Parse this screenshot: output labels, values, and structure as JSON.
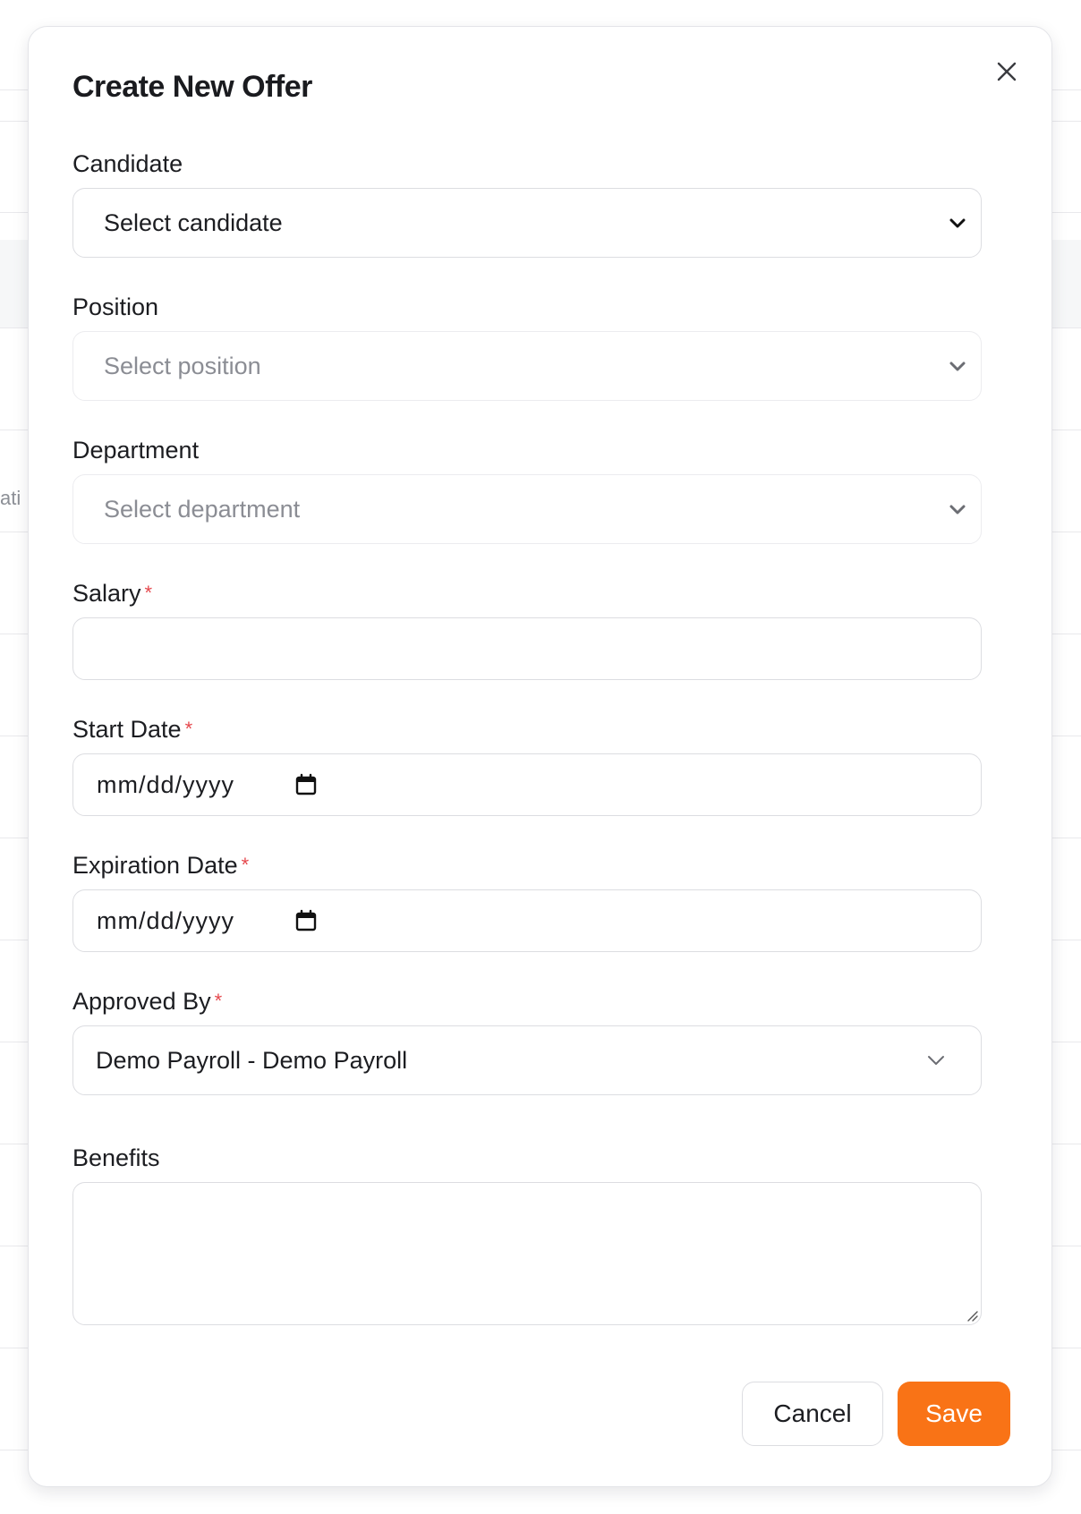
{
  "modal": {
    "title": "Create New Offer",
    "close_icon": "close-icon"
  },
  "form": {
    "candidate": {
      "label": "Candidate",
      "value": "Select candidate",
      "required": false
    },
    "position": {
      "label": "Position",
      "value": "Select position",
      "disabled": true,
      "required": false
    },
    "department": {
      "label": "Department",
      "value": "Select department",
      "disabled": true,
      "required": false
    },
    "salary": {
      "label": "Salary",
      "value": "",
      "required": true
    },
    "start_date": {
      "label": "Start Date",
      "placeholder": "mm/dd/yyyy",
      "required": true
    },
    "expiration_date": {
      "label": "Expiration Date",
      "placeholder": "mm/dd/yyyy",
      "required": true
    },
    "approved_by": {
      "label": "Approved By",
      "value": "Demo Payroll - Demo Payroll",
      "required": true
    },
    "benefits": {
      "label": "Benefits",
      "value": ""
    },
    "required_marker": "*"
  },
  "actions": {
    "cancel_label": "Cancel",
    "save_label": "Save"
  },
  "background": {
    "truncated_text": "ati"
  },
  "colors": {
    "accent": "#f97316",
    "required": "#e5484d",
    "border": "#dcdde1"
  }
}
